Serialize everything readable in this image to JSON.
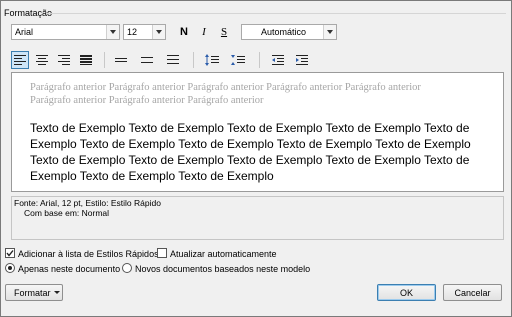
{
  "formatting": {
    "section_label": "Formatação",
    "font_name": "Arial",
    "font_size": "12",
    "bold_label": "N",
    "italic_label": "I",
    "underline_label": "S",
    "font_color": "Automático"
  },
  "toolbar": {
    "icons": [
      "align-left-icon",
      "align-center-icon",
      "align-right-icon",
      "justify-icon",
      "single-spacing-icon",
      "one-half-spacing-icon",
      "double-spacing-icon",
      "increase-spacing-before-icon",
      "decrease-spacing-before-icon",
      "decrease-indent-icon",
      "increase-indent-icon"
    ],
    "selected": "align-left-icon"
  },
  "preview": {
    "previous_paragraph": "Parágrafo anterior Parágrafo anterior Parágrafo anterior Parágrafo anterior Parágrafo anterior Parágrafo anterior Parágrafo anterior Parágrafo anterior",
    "sample_text": "Texto de Exemplo Texto de Exemplo Texto de Exemplo Texto de Exemplo Texto de Exemplo Texto de Exemplo Texto de Exemplo Texto de Exemplo Texto de Exemplo Texto de Exemplo Texto de Exemplo Texto de Exemplo Texto de Exemplo Texto de Exemplo Texto de Exemplo Texto de Exemplo"
  },
  "description": {
    "line1": "Fonte: Arial, 12 pt, Estilo: Estilo Rápido",
    "line2": "Com base em: Normal"
  },
  "options": {
    "add_to_quick_styles": "Adicionar à lista de Estilos Rápidos",
    "auto_update": "Atualizar automaticamente",
    "only_this_document": "Apenas neste documento",
    "new_documents": "Novos documentos baseados neste modelo"
  },
  "buttons": {
    "format": "Formatar",
    "ok": "OK",
    "cancel": "Cancelar"
  },
  "colors": {
    "selected_border": "#3c7fb1",
    "selected_fill": "#cfe6f8",
    "preview_gray": "#a6a6a6"
  }
}
